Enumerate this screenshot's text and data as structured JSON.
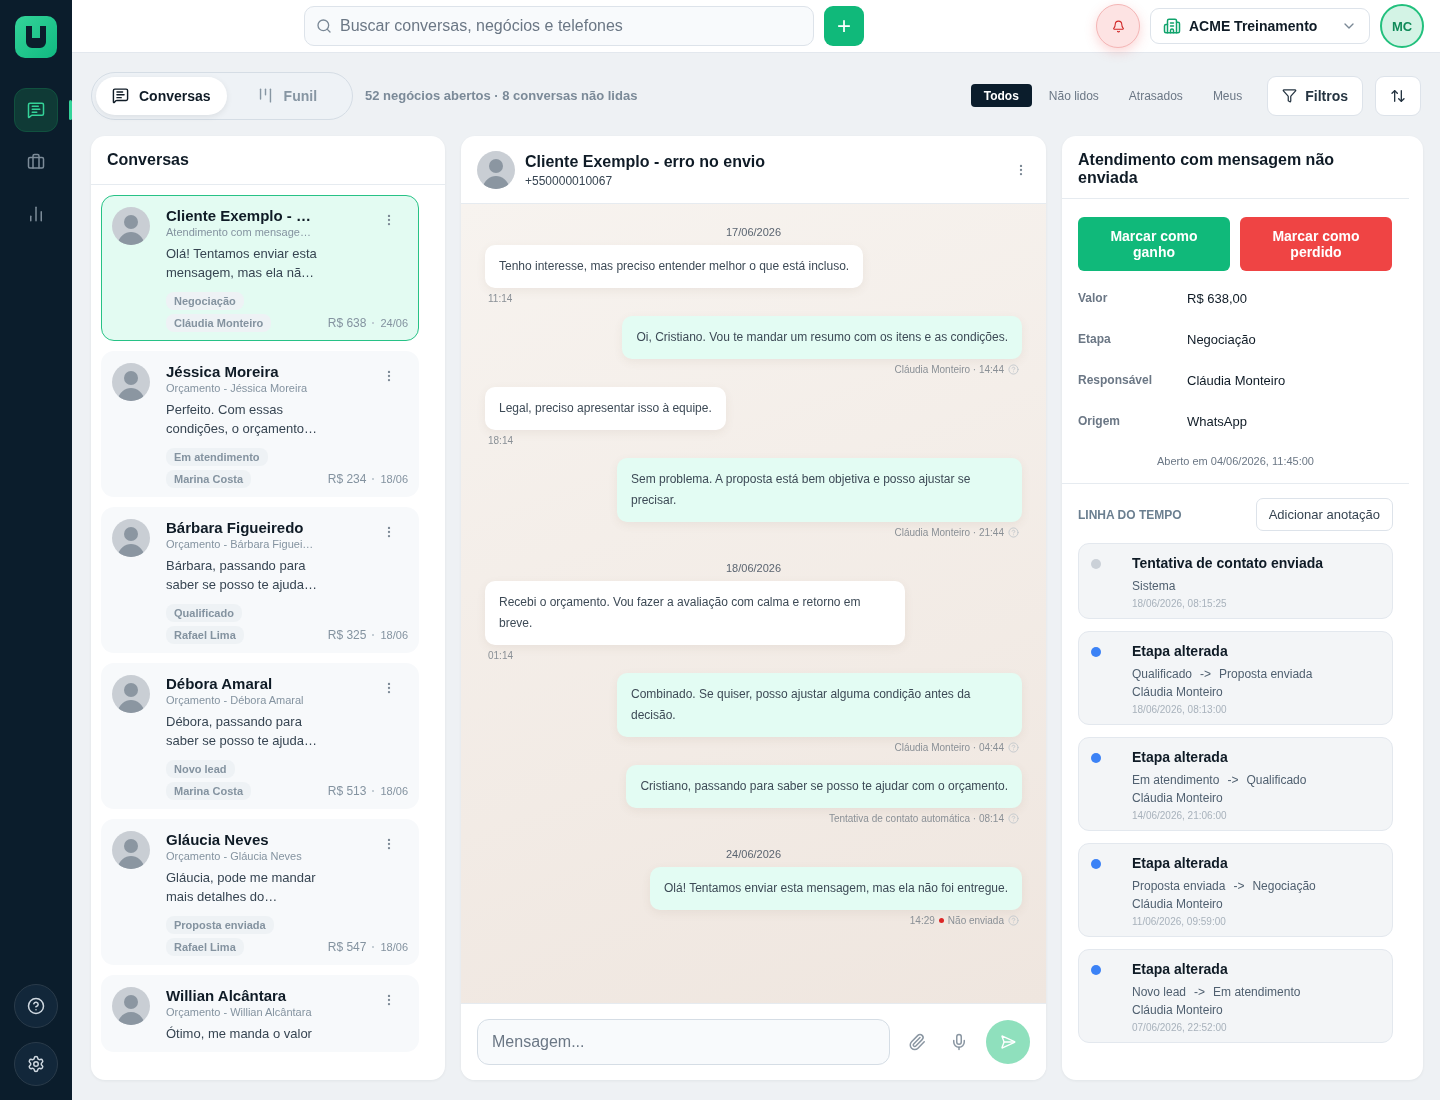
{
  "sidebar": {
    "items": [
      {
        "selected": true
      },
      {
        "selected": false
      },
      {
        "selected": false
      }
    ]
  },
  "topbar": {
    "search": {
      "placeholder": "Buscar conversas, negócios e telefones"
    },
    "add_label": "+",
    "workspace": "ACME Treinamento",
    "user_initials": "MC"
  },
  "view_tabs": [
    {
      "label": "Conversas",
      "selected": true
    },
    {
      "label": "Funil",
      "selected": false
    }
  ],
  "summary": "52 negócios abertos · 8 conversas não lidas",
  "filters": [
    {
      "label": "Todos",
      "selected": true
    },
    {
      "label": "Não lidos",
      "selected": false
    },
    {
      "label": "Atrasados",
      "selected": false
    },
    {
      "label": "Meus",
      "selected": false
    }
  ],
  "filters_button": "Filtros",
  "conversations": {
    "title": "Conversas",
    "items": [
      {
        "name": "Cliente Exemplo - …",
        "subtitle": "Atendimento com mensage…",
        "preview": "Olá! Tentamos enviar esta mensagem, mas ela nã…",
        "stage": "Negociação",
        "owner": "Cláudia Monteiro",
        "value": "R$ 638",
        "date": "24/06",
        "selected": true
      },
      {
        "name": "Jéssica Moreira",
        "subtitle": "Orçamento - Jéssica Moreira",
        "preview": "Perfeito. Com essas condições, o orçamento…",
        "stage": "Em atendimento",
        "owner": "Marina Costa",
        "value": "R$ 234",
        "date": "18/06",
        "selected": false
      },
      {
        "name": "Bárbara Figueiredo",
        "subtitle": "Orçamento - Bárbara Figuei…",
        "preview": "Bárbara, passando para saber se posso te ajuda…",
        "stage": "Qualificado",
        "owner": "Rafael Lima",
        "value": "R$ 325",
        "date": "18/06",
        "selected": false
      },
      {
        "name": "Débora Amaral",
        "subtitle": "Orçamento - Débora Amaral",
        "preview": "Débora, passando para saber se posso te ajuda…",
        "stage": "Novo lead",
        "owner": "Marina Costa",
        "value": "R$ 513",
        "date": "18/06",
        "selected": false
      },
      {
        "name": "Gláucia Neves",
        "subtitle": "Orçamento - Gláucia Neves",
        "preview": "Gláucia, pode me mandar mais detalhes do…",
        "stage": "Proposta enviada",
        "owner": "Rafael Lima",
        "value": "R$ 547",
        "date": "18/06",
        "selected": false
      },
      {
        "name": "Willian Alcântara",
        "subtitle": "Orçamento - Willian Alcântara",
        "preview": "Ótimo, me manda o valor",
        "selected": false
      }
    ]
  },
  "chat": {
    "title": "Cliente Exemplo - erro no envio",
    "phone": "+550000010067",
    "composer_placeholder": "Mensagem...",
    "messages": [
      {
        "kind": "date",
        "text": "17/06/2026"
      },
      {
        "kind": "in",
        "text": "Tenho interesse, mas preciso entender melhor o que está incluso.",
        "meta": "11:14"
      },
      {
        "kind": "out",
        "text": "Oi, Cristiano. Vou te mandar um resumo com os itens e as condições.",
        "meta": "Cláudia Monteiro · 14:44"
      },
      {
        "kind": "in",
        "text": "Legal, preciso apresentar isso à equipe.",
        "meta": "18:14"
      },
      {
        "kind": "out",
        "text": "Sem problema. A proposta está bem objetiva e posso ajustar se precisar.",
        "meta": "Cláudia Monteiro · 21:44"
      },
      {
        "kind": "date",
        "text": "18/06/2026"
      },
      {
        "kind": "in",
        "text": "Recebi o orçamento. Vou fazer a avaliação com calma e retorno em breve.",
        "meta": "01:14"
      },
      {
        "kind": "out",
        "text": "Combinado. Se quiser, posso ajustar alguma condição antes da decisão.",
        "meta": "Cláudia Monteiro · 04:44"
      },
      {
        "kind": "out",
        "text": "Cristiano, passando para saber se posso te ajudar com o orçamento.",
        "meta": "Tentativa de contato automática · 08:14"
      },
      {
        "kind": "date",
        "text": "24/06/2026"
      },
      {
        "kind": "failed",
        "text": "Olá! Tentamos enviar esta mensagem, mas ela não foi entregue.",
        "meta": "14:29",
        "status": "Não enviada"
      }
    ]
  },
  "details": {
    "title": "Atendimento com mensagem não enviada",
    "won_button": "Marcar como ganho",
    "lost_button": "Marcar como perdido",
    "fields": [
      {
        "label": "Valor",
        "value": "R$ 638,00"
      },
      {
        "label": "Etapa",
        "value": "Negociação"
      },
      {
        "label": "Responsável",
        "value": "Cláudia Monteiro"
      },
      {
        "label": "Origem",
        "value": "WhatsApp"
      }
    ],
    "opened": "Aberto em 04/06/2026, 11:45:00",
    "timeline_title": "LINHA DO TEMPO",
    "add_note": "Adicionar anotação",
    "timeline": [
      {
        "title": "Tentativa de contato enviada",
        "kind": "note",
        "author": "Sistema",
        "time": "18/06/2026, 08:15:25",
        "color": "#cbd1d8"
      },
      {
        "title": "Etapa alterada",
        "kind": "stage",
        "from": "Qualificado",
        "arrow": "->",
        "to": "Proposta enviada",
        "author": "Cláudia Monteiro",
        "time": "18/06/2026, 08:13:00",
        "color": "#3b82f6"
      },
      {
        "title": "Etapa alterada",
        "kind": "stage",
        "from": "Em atendimento",
        "arrow": "->",
        "to": "Qualificado",
        "author": "Cláudia Monteiro",
        "time": "14/06/2026, 21:06:00",
        "color": "#3b82f6"
      },
      {
        "title": "Etapa alterada",
        "kind": "stage",
        "from": "Proposta enviada",
        "arrow": "->",
        "to": "Negociação",
        "author": "Cláudia Monteiro",
        "time": "11/06/2026, 09:59:00",
        "color": "#3b82f6"
      },
      {
        "title": "Etapa alterada",
        "kind": "stage",
        "from": "Novo lead",
        "arrow": "->",
        "to": "Em atendimento",
        "author": "Cláudia Monteiro",
        "time": "07/06/2026, 22:52:00",
        "color": "#3b82f6"
      }
    ]
  }
}
